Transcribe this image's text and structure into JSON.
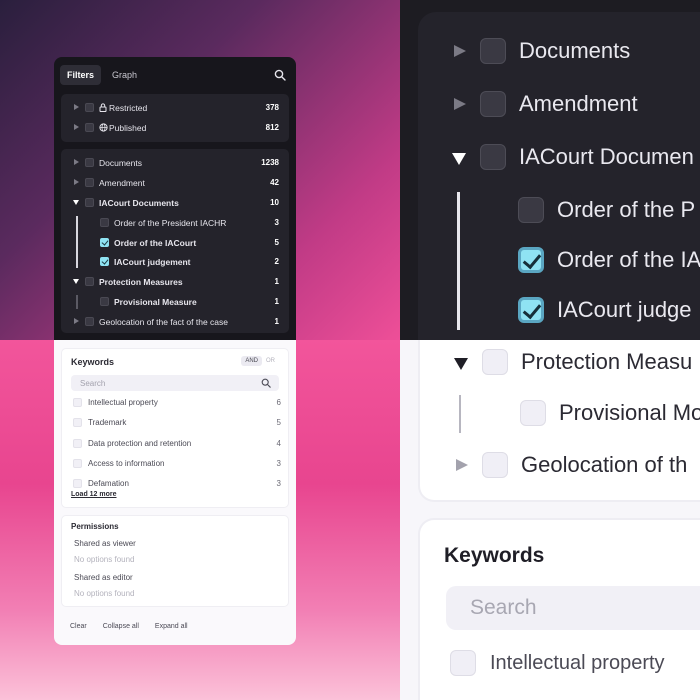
{
  "panel": {
    "tabs": [
      {
        "label": "Filters",
        "active": true
      },
      {
        "label": "Graph",
        "active": false
      }
    ],
    "search_icon": "search-icon",
    "access": [
      {
        "label": "Restricted",
        "icon": "lock-icon",
        "count": "378"
      },
      {
        "label": "Published",
        "icon": "globe-icon",
        "count": "812"
      }
    ],
    "types": [
      {
        "label": "Documents",
        "count": "1238",
        "expanded": false,
        "checked": false
      },
      {
        "label": "Amendment",
        "count": "42",
        "expanded": false,
        "checked": false
      },
      {
        "label": "IACourt Documents",
        "count": "10",
        "expanded": true,
        "checked": false,
        "children": [
          {
            "label": "Order of the President IACHR",
            "count": "3",
            "checked": false
          },
          {
            "label": "Order of the IACourt",
            "count": "5",
            "checked": true
          },
          {
            "label": "IACourt judgement",
            "count": "2",
            "checked": true
          }
        ]
      },
      {
        "label": "Protection Measures",
        "count": "1",
        "expanded": true,
        "checked": false,
        "children": [
          {
            "label": "Provisional Measure",
            "count": "1",
            "checked": false
          }
        ]
      },
      {
        "label": "Geolocation of the fact of the case",
        "count": "1",
        "expanded": false,
        "checked": false
      }
    ],
    "keywords": {
      "title": "Keywords",
      "and_label": "AND",
      "or_label": "OR",
      "search_placeholder": "Search",
      "items": [
        {
          "label": "Intellectual property",
          "count": "6"
        },
        {
          "label": "Trademark",
          "count": "5"
        },
        {
          "label": "Data protection and retention",
          "count": "4"
        },
        {
          "label": "Access to information",
          "count": "3"
        },
        {
          "label": "Defamation",
          "count": "3"
        }
      ],
      "load_more": "Load 12 more"
    },
    "permissions": {
      "title": "Permissions",
      "viewer_label": "Shared as viewer",
      "viewer_empty": "No options found",
      "editor_label": "Shared as editor",
      "editor_empty": "No options found"
    },
    "footer": {
      "clear": "Clear",
      "collapse": "Collapse all",
      "expand": "Expand all"
    }
  },
  "zoom": {
    "rows": [
      {
        "label": "Documents"
      },
      {
        "label": "Amendment"
      },
      {
        "label": "IACourt Documen"
      },
      {
        "label": "Order of the P"
      },
      {
        "label": "Order of the IA"
      },
      {
        "label": "IACourt judge"
      },
      {
        "label": "Protection Measu"
      },
      {
        "label": "Provisional Mo"
      },
      {
        "label": "Geolocation of th"
      }
    ],
    "keywords_title": "Keywords",
    "search_placeholder": "Search",
    "first_keyword": "Intellectual property"
  },
  "colors": {
    "checkbox_on": "#8fe3f3",
    "panel_dark": "#17161c",
    "panel_box": "#24232b",
    "panel_light": "#faf9fc"
  }
}
